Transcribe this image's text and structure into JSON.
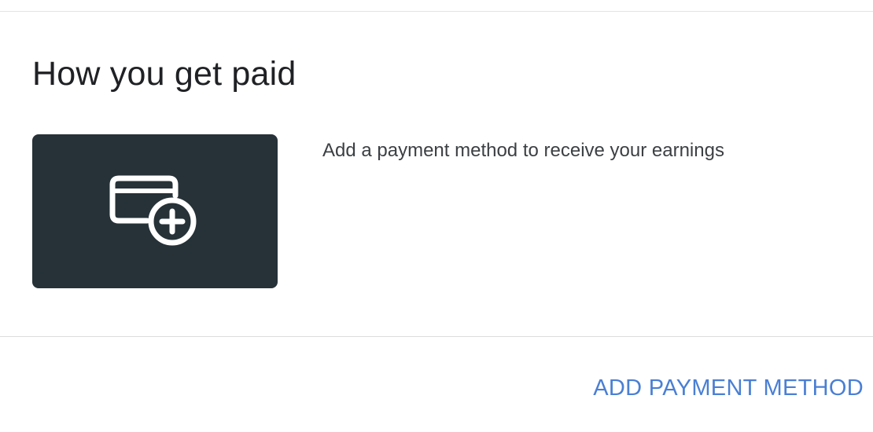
{
  "section": {
    "title": "How you get paid",
    "description": "Add a payment method to receive your earnings"
  },
  "tile": {
    "icon": "credit-card-add-icon",
    "background_color": "#263238"
  },
  "actions": {
    "add_payment_method_label": "ADD PAYMENT METHOD",
    "accent_color": "#4a7fd4"
  }
}
